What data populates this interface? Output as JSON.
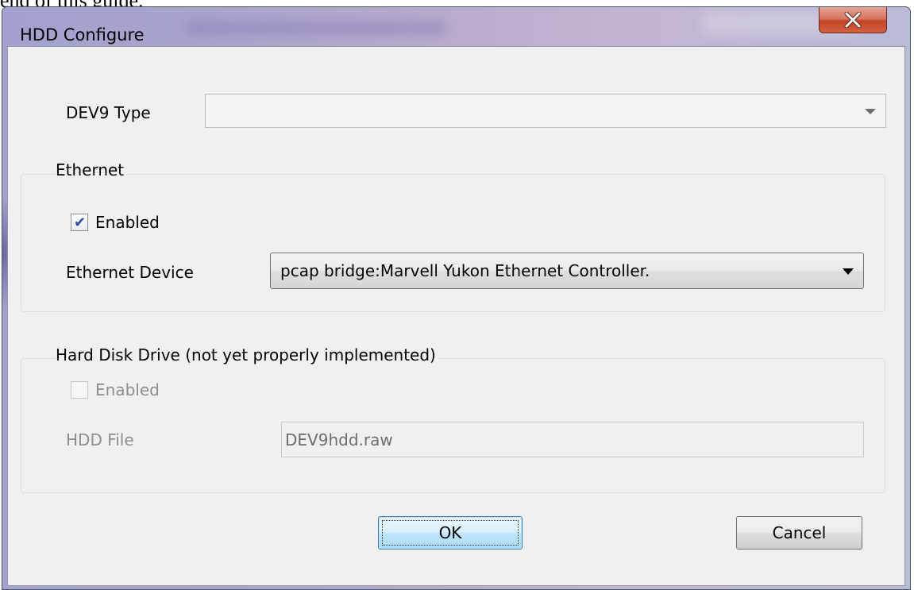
{
  "background_text": "end of this guide.",
  "window": {
    "title": "HDD Configure",
    "close_label": "X"
  },
  "dev9": {
    "label": "DEV9 Type",
    "value": ""
  },
  "ethernet": {
    "group_title": "Ethernet",
    "enabled_label": "Enabled",
    "enabled": true,
    "device_label": "Ethernet Device",
    "device_value": "pcap bridge:Marvell Yukon Ethernet Controller."
  },
  "hdd": {
    "group_title": "Hard Disk Drive (not yet properly implemented)",
    "enabled_label": "Enabled",
    "enabled": false,
    "file_label": "HDD File",
    "file_value": "DEV9hdd.raw"
  },
  "buttons": {
    "ok_label": "OK",
    "cancel_label": "Cancel"
  }
}
